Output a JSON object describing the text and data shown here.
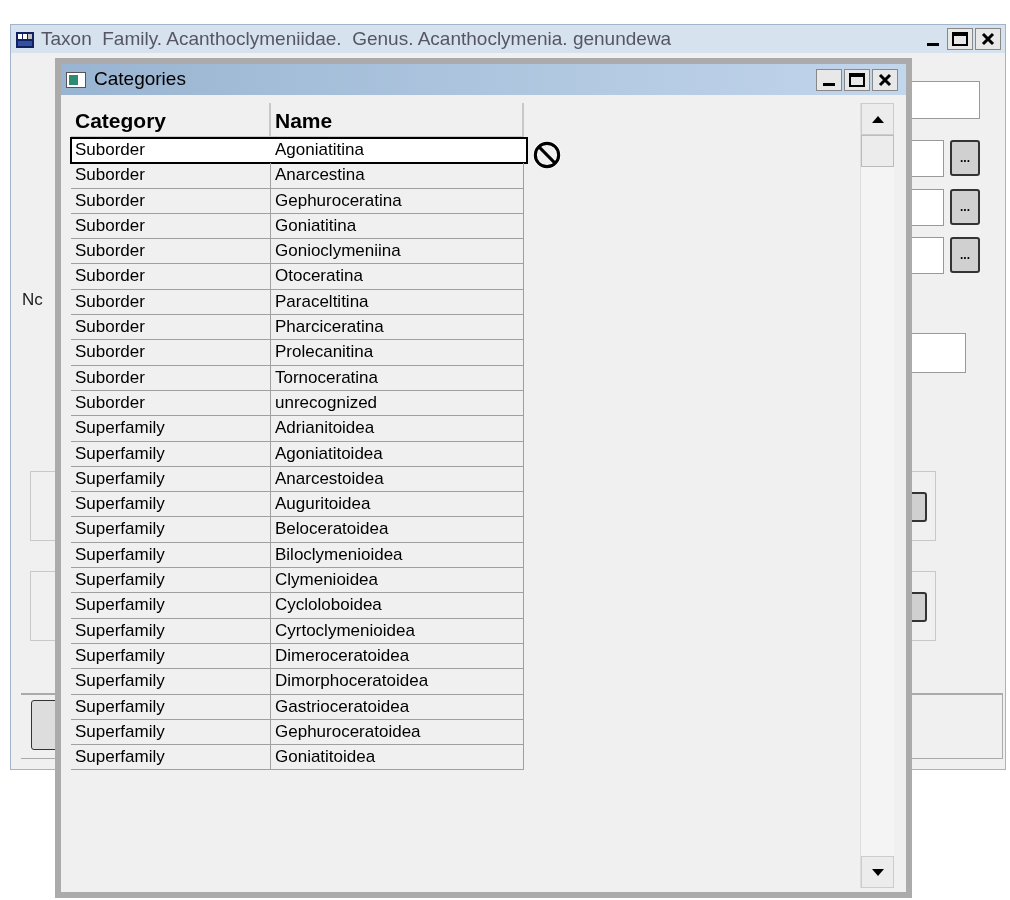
{
  "main_window": {
    "title": "Taxon  Family. Acanthoclymeniidae.  Genus. Acanthoclymenia. genundewa",
    "label": "Nc",
    "browse_buttons": [
      "...",
      "...",
      "..."
    ]
  },
  "dialog": {
    "title": "Categories",
    "columns": [
      "Category",
      "Name"
    ],
    "rows": [
      {
        "category": "Suborder",
        "name": "Agoniatitina",
        "selected": true
      },
      {
        "category": "Suborder",
        "name": "Anarcestina",
        "selected": false
      },
      {
        "category": "Suborder",
        "name": "Gephuroceratina",
        "selected": false
      },
      {
        "category": "Suborder",
        "name": "Goniatitina",
        "selected": false
      },
      {
        "category": "Suborder",
        "name": "Gonioclymeniina",
        "selected": false
      },
      {
        "category": "Suborder",
        "name": "Otoceratina",
        "selected": false
      },
      {
        "category": "Suborder",
        "name": "Paraceltitina",
        "selected": false
      },
      {
        "category": "Suborder",
        "name": "Pharciceratina",
        "selected": false
      },
      {
        "category": "Suborder",
        "name": "Prolecanitina",
        "selected": false
      },
      {
        "category": "Suborder",
        "name": "Tornoceratina",
        "selected": false
      },
      {
        "category": "Suborder",
        "name": "unrecognized",
        "selected": false
      },
      {
        "category": "Superfamily",
        "name": "Adrianitoidea",
        "selected": false
      },
      {
        "category": "Superfamily",
        "name": "Agoniatitoidea",
        "selected": false
      },
      {
        "category": "Superfamily",
        "name": "Anarcestoidea",
        "selected": false
      },
      {
        "category": "Superfamily",
        "name": "Auguritoidea",
        "selected": false
      },
      {
        "category": "Superfamily",
        "name": "Beloceratoidea",
        "selected": false
      },
      {
        "category": "Superfamily",
        "name": "Biloclymenioidea",
        "selected": false
      },
      {
        "category": "Superfamily",
        "name": "Clymenioidea",
        "selected": false
      },
      {
        "category": "Superfamily",
        "name": "Cycloloboidea",
        "selected": false
      },
      {
        "category": "Superfamily",
        "name": "Cyrtoclymenioidea",
        "selected": false
      },
      {
        "category": "Superfamily",
        "name": "Dimeroceratoidea",
        "selected": false
      },
      {
        "category": "Superfamily",
        "name": "Dimorphoceratoidea",
        "selected": false
      },
      {
        "category": "Superfamily",
        "name": "Gastrioceratoidea",
        "selected": false
      },
      {
        "category": "Superfamily",
        "name": "Gephuroceratoidea",
        "selected": false
      },
      {
        "category": "Superfamily",
        "name": "Goniatitoidea",
        "selected": false
      }
    ]
  }
}
